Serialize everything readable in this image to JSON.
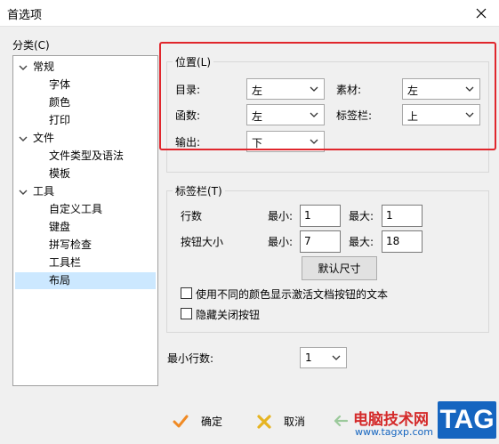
{
  "window": {
    "title": "首选项"
  },
  "category": {
    "label": "分类(C)",
    "tree": [
      {
        "label": "常规",
        "level": 0,
        "expanded": true
      },
      {
        "label": "字体",
        "level": 1
      },
      {
        "label": "颜色",
        "level": 1
      },
      {
        "label": "打印",
        "level": 1
      },
      {
        "label": "文件",
        "level": 0,
        "expanded": true
      },
      {
        "label": "文件类型及语法",
        "level": 1
      },
      {
        "label": "模板",
        "level": 1
      },
      {
        "label": "工具",
        "level": 0,
        "expanded": true
      },
      {
        "label": "自定义工具",
        "level": 1
      },
      {
        "label": "键盘",
        "level": 1
      },
      {
        "label": "拼写检查",
        "level": 1
      },
      {
        "label": "工具栏",
        "level": 1
      },
      {
        "label": "布局",
        "level": 1,
        "selected": true
      }
    ]
  },
  "position": {
    "title": "位置(L)",
    "directory_label": "目录:",
    "directory_value": "左",
    "materials_label": "素材:",
    "materials_value": "左",
    "functions_label": "函数:",
    "functions_value": "左",
    "tabbar_label": "标签栏:",
    "tabbar_value": "上",
    "output_label": "输出:",
    "output_value": "下"
  },
  "tabbar": {
    "title": "标签栏(T)",
    "rows_label": "行数",
    "rows_min_label": "最小:",
    "rows_min": "1",
    "rows_max_label": "最大:",
    "rows_max": "1",
    "btnsize_label": "按钮大小",
    "btnsize_min_label": "最小:",
    "btnsize_min": "7",
    "btnsize_max_label": "最大:",
    "btnsize_max": "18",
    "default_size_button": "默认尺寸",
    "check_colors_label": "使用不同的颜色显示激活文档按钮的文本",
    "check_colors_checked": false,
    "check_hide_close_label": "隐藏关闭按钮",
    "check_hide_close_checked": false
  },
  "min_rows": {
    "label": "最小行数:",
    "value": "1"
  },
  "buttons": {
    "ok": "确定",
    "cancel": "取消"
  },
  "watermark": {
    "text": "电脑技术网",
    "url": "www.tagxp.com",
    "logo": "TAG"
  },
  "colors": {
    "highlight": "#e0262c",
    "selection": "#cce8ff",
    "ok_icon": "#f08a24",
    "cancel_icon": "#e6b422",
    "logo_bg": "#1565c0"
  }
}
